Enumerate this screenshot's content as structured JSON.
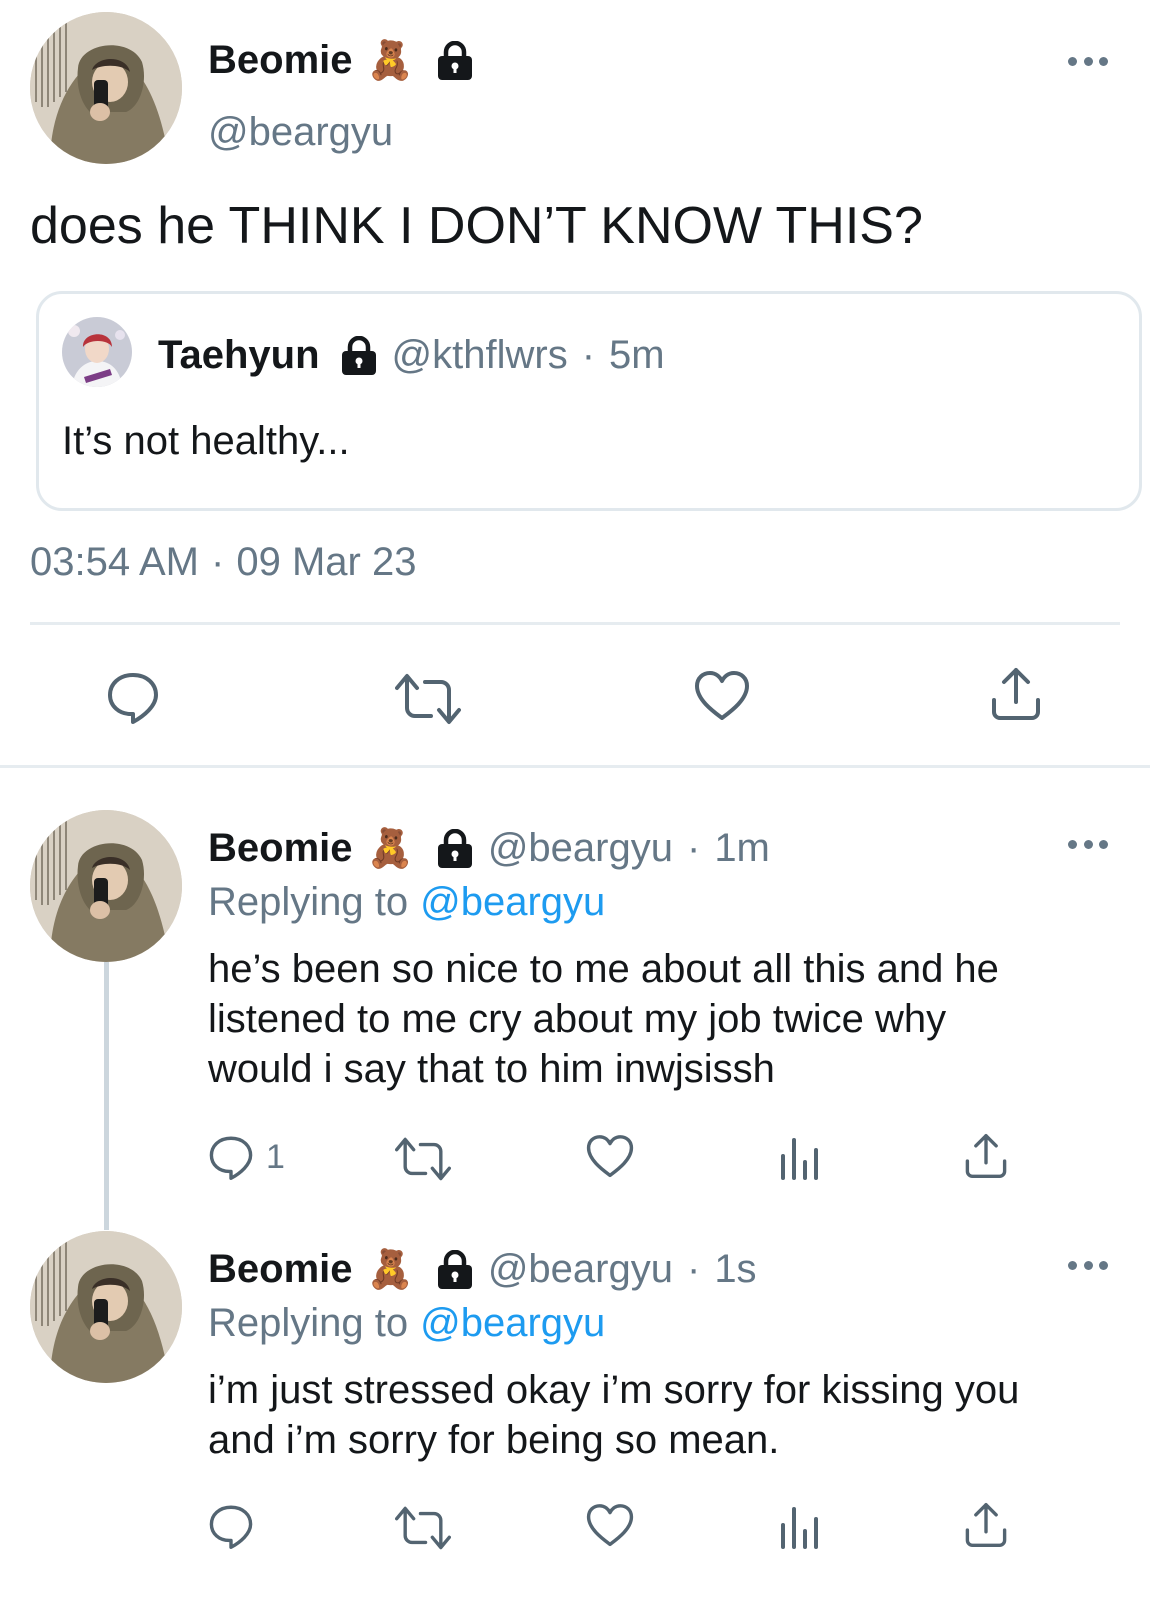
{
  "main_tweet": {
    "author_name": "Beomie",
    "author_emoji": "🧸",
    "author_handle": "@beargyu",
    "text": "does he THINK I DON’T KNOW THIS?",
    "quoted": {
      "author_name": "Taehyun",
      "author_handle": "@kthflwrs",
      "separator": "·",
      "time": "5m",
      "text": "It’s not healthy..."
    },
    "timestamp_time": "03:54 AM",
    "timestamp_sep": "·",
    "timestamp_date": "09 Mar 23"
  },
  "replies": [
    {
      "author_name": "Beomie",
      "author_emoji": "🧸",
      "author_handle": "@beargyu",
      "separator": "·",
      "time": "1m",
      "replying_label": "Replying to",
      "replying_to": "@beargyu",
      "lines": [
        "he’s been so nice to me about all this and he",
        "listened to me cry about my job twice why",
        "would i say that to him inwjsissh"
      ],
      "reply_count": "1"
    },
    {
      "author_name": "Beomie",
      "author_emoji": "🧸",
      "author_handle": "@beargyu",
      "separator": "·",
      "time": "1s",
      "replying_label": "Replying to",
      "replying_to": "@beargyu",
      "lines": [
        "i’m just stressed okay i’m sorry for kissing you",
        "and i’m sorry for being so mean."
      ],
      "reply_count": ""
    }
  ],
  "icons": {
    "reply": "reply-icon",
    "retweet": "retweet-icon",
    "like": "heart-icon",
    "views": "views-icon",
    "share": "share-icon",
    "more": "more-icon",
    "lock": "lock-icon"
  },
  "colors": {
    "link": "#1d9bf0",
    "secondary_text": "#657786",
    "divider": "#e6ecf0"
  }
}
